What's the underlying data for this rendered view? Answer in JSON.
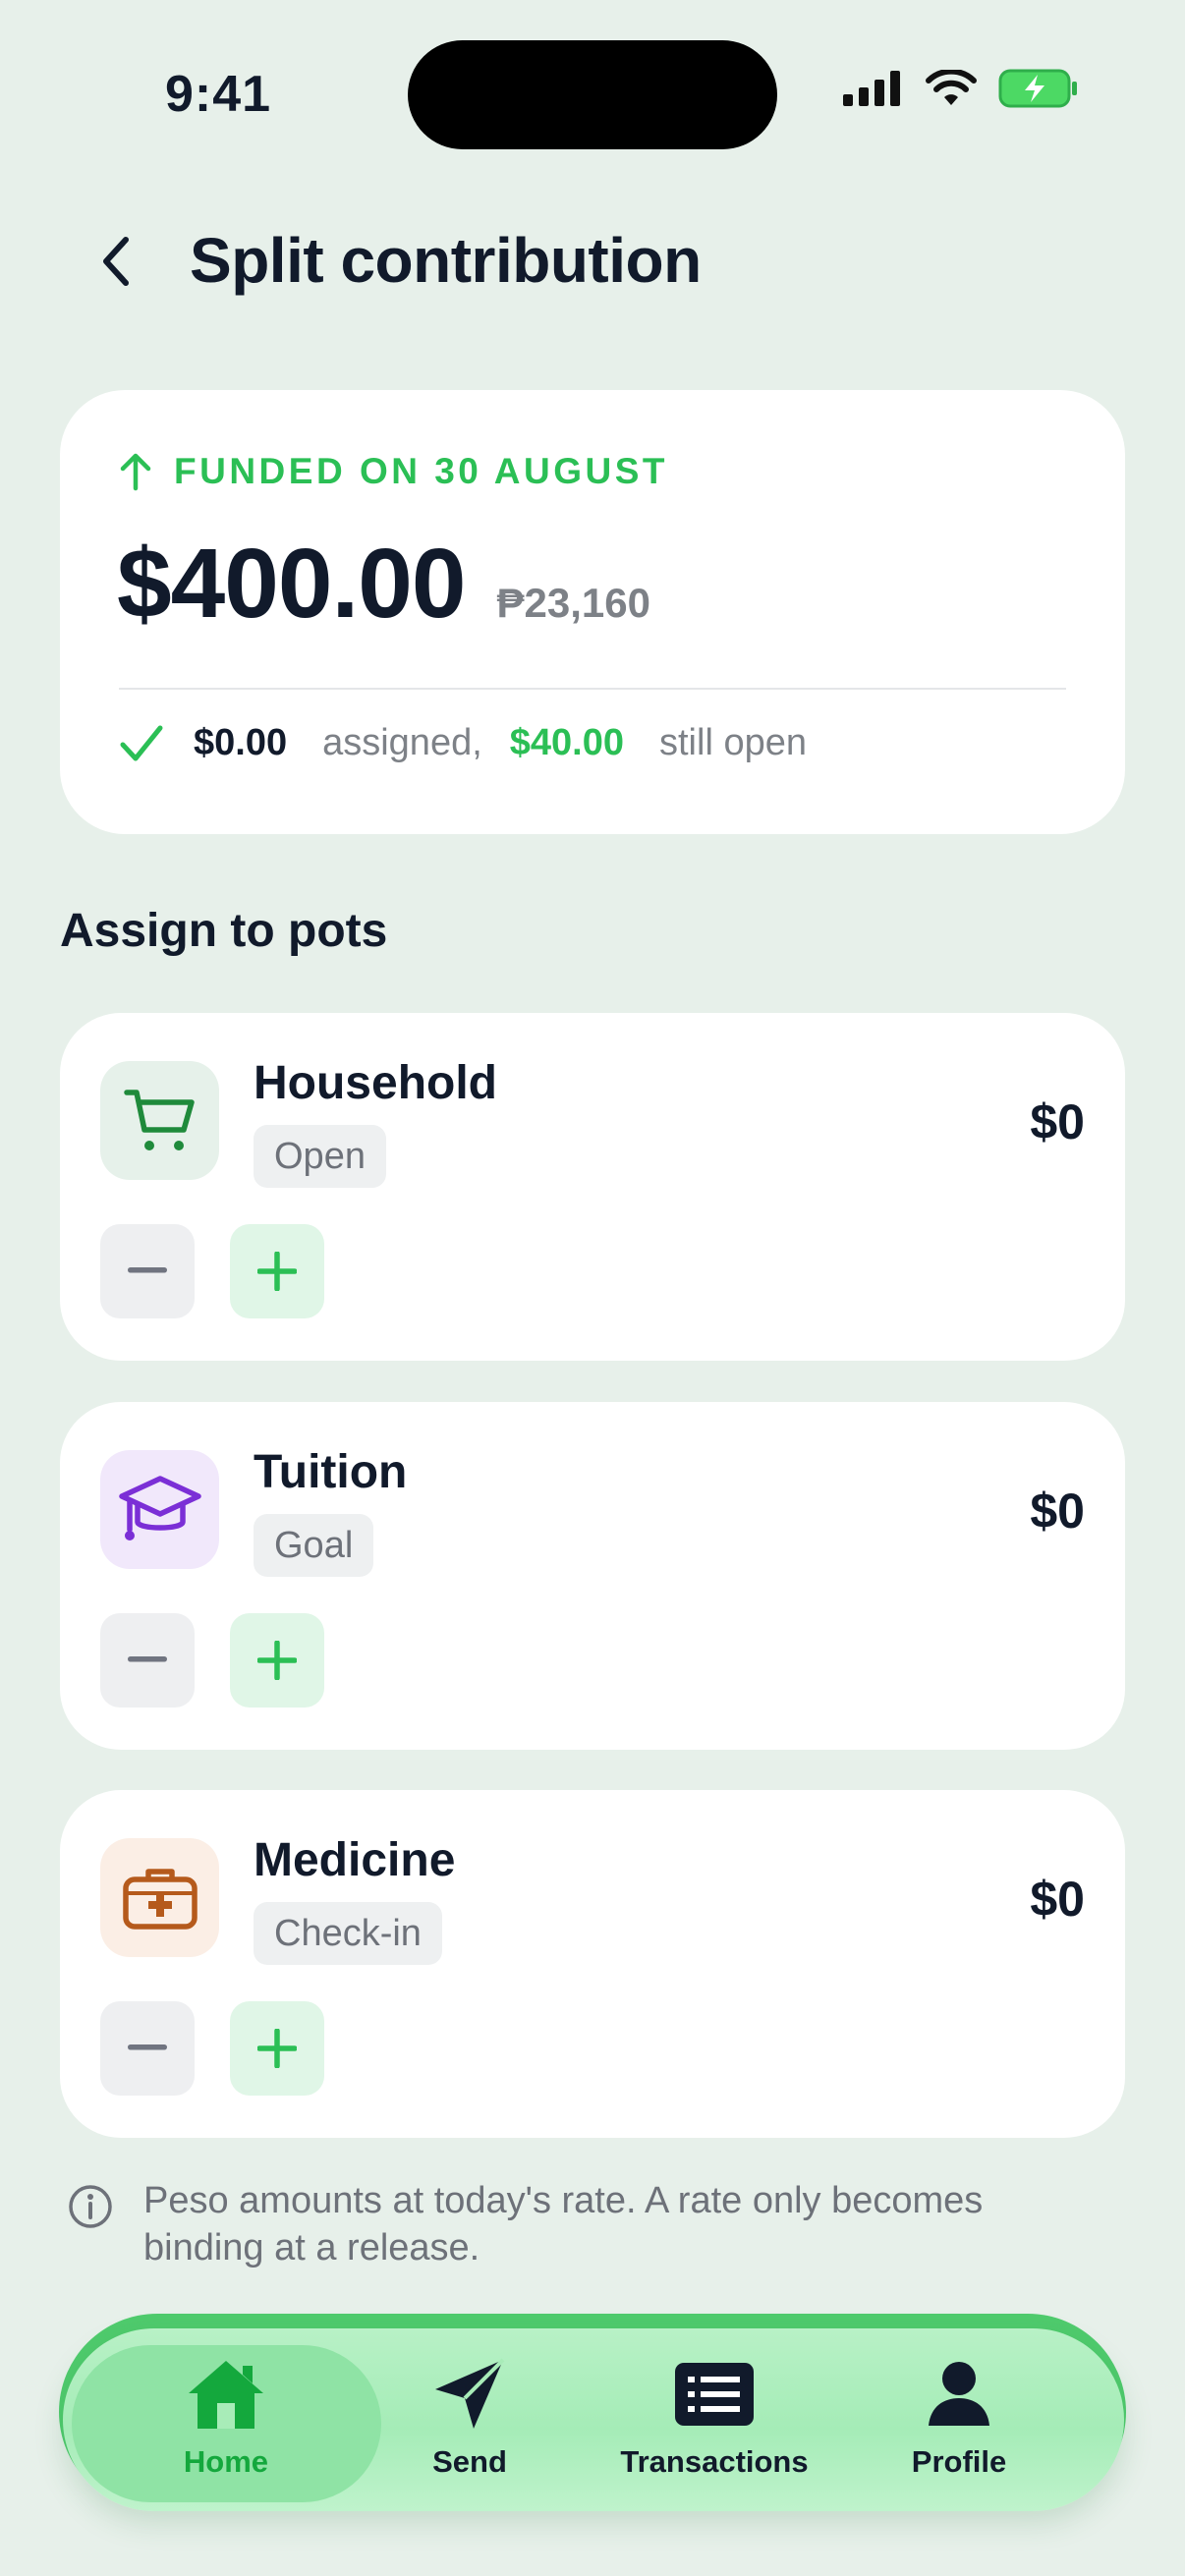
{
  "status_bar": {
    "time": "9:41"
  },
  "header": {
    "title": "Split contribution"
  },
  "summary": {
    "funded_label": "FUNDED ON 30 AUGUST",
    "amount_usd": "$400.00",
    "amount_php": "₱23,160",
    "assigned_value": "$0.00",
    "assigned_text": "assigned,",
    "open_value": "$40.00",
    "open_text": "still open"
  },
  "section_title": "Assign to pots",
  "pots": [
    {
      "name": "Household",
      "badge": "Open",
      "amount": "$0",
      "icon": "shopping-cart-icon",
      "color": "#1f8a3b",
      "bg": "#e6f1ea"
    },
    {
      "name": "Tuition",
      "badge": "Goal",
      "amount": "$0",
      "icon": "graduation-cap-icon",
      "color": "#7b2fd6",
      "bg": "#f1e8fb"
    },
    {
      "name": "Medicine",
      "badge": "Check-in",
      "amount": "$0",
      "icon": "medical-kit-icon",
      "color": "#b55a1c",
      "bg": "#fbeee5"
    }
  ],
  "info_note": "Peso amounts at today's rate. A rate only becomes binding at a release.",
  "tabbar": {
    "tabs": [
      {
        "label": "Home",
        "icon": "home-icon",
        "active": true
      },
      {
        "label": "Send",
        "icon": "send-icon",
        "active": false
      },
      {
        "label": "Transactions",
        "icon": "transactions-icon",
        "active": false
      },
      {
        "label": "Profile",
        "icon": "profile-icon",
        "active": false
      }
    ]
  },
  "colors": {
    "accent": "#2bbf55",
    "background": "#e7f0ea",
    "text": "#111a2b",
    "muted": "#7d8187"
  }
}
